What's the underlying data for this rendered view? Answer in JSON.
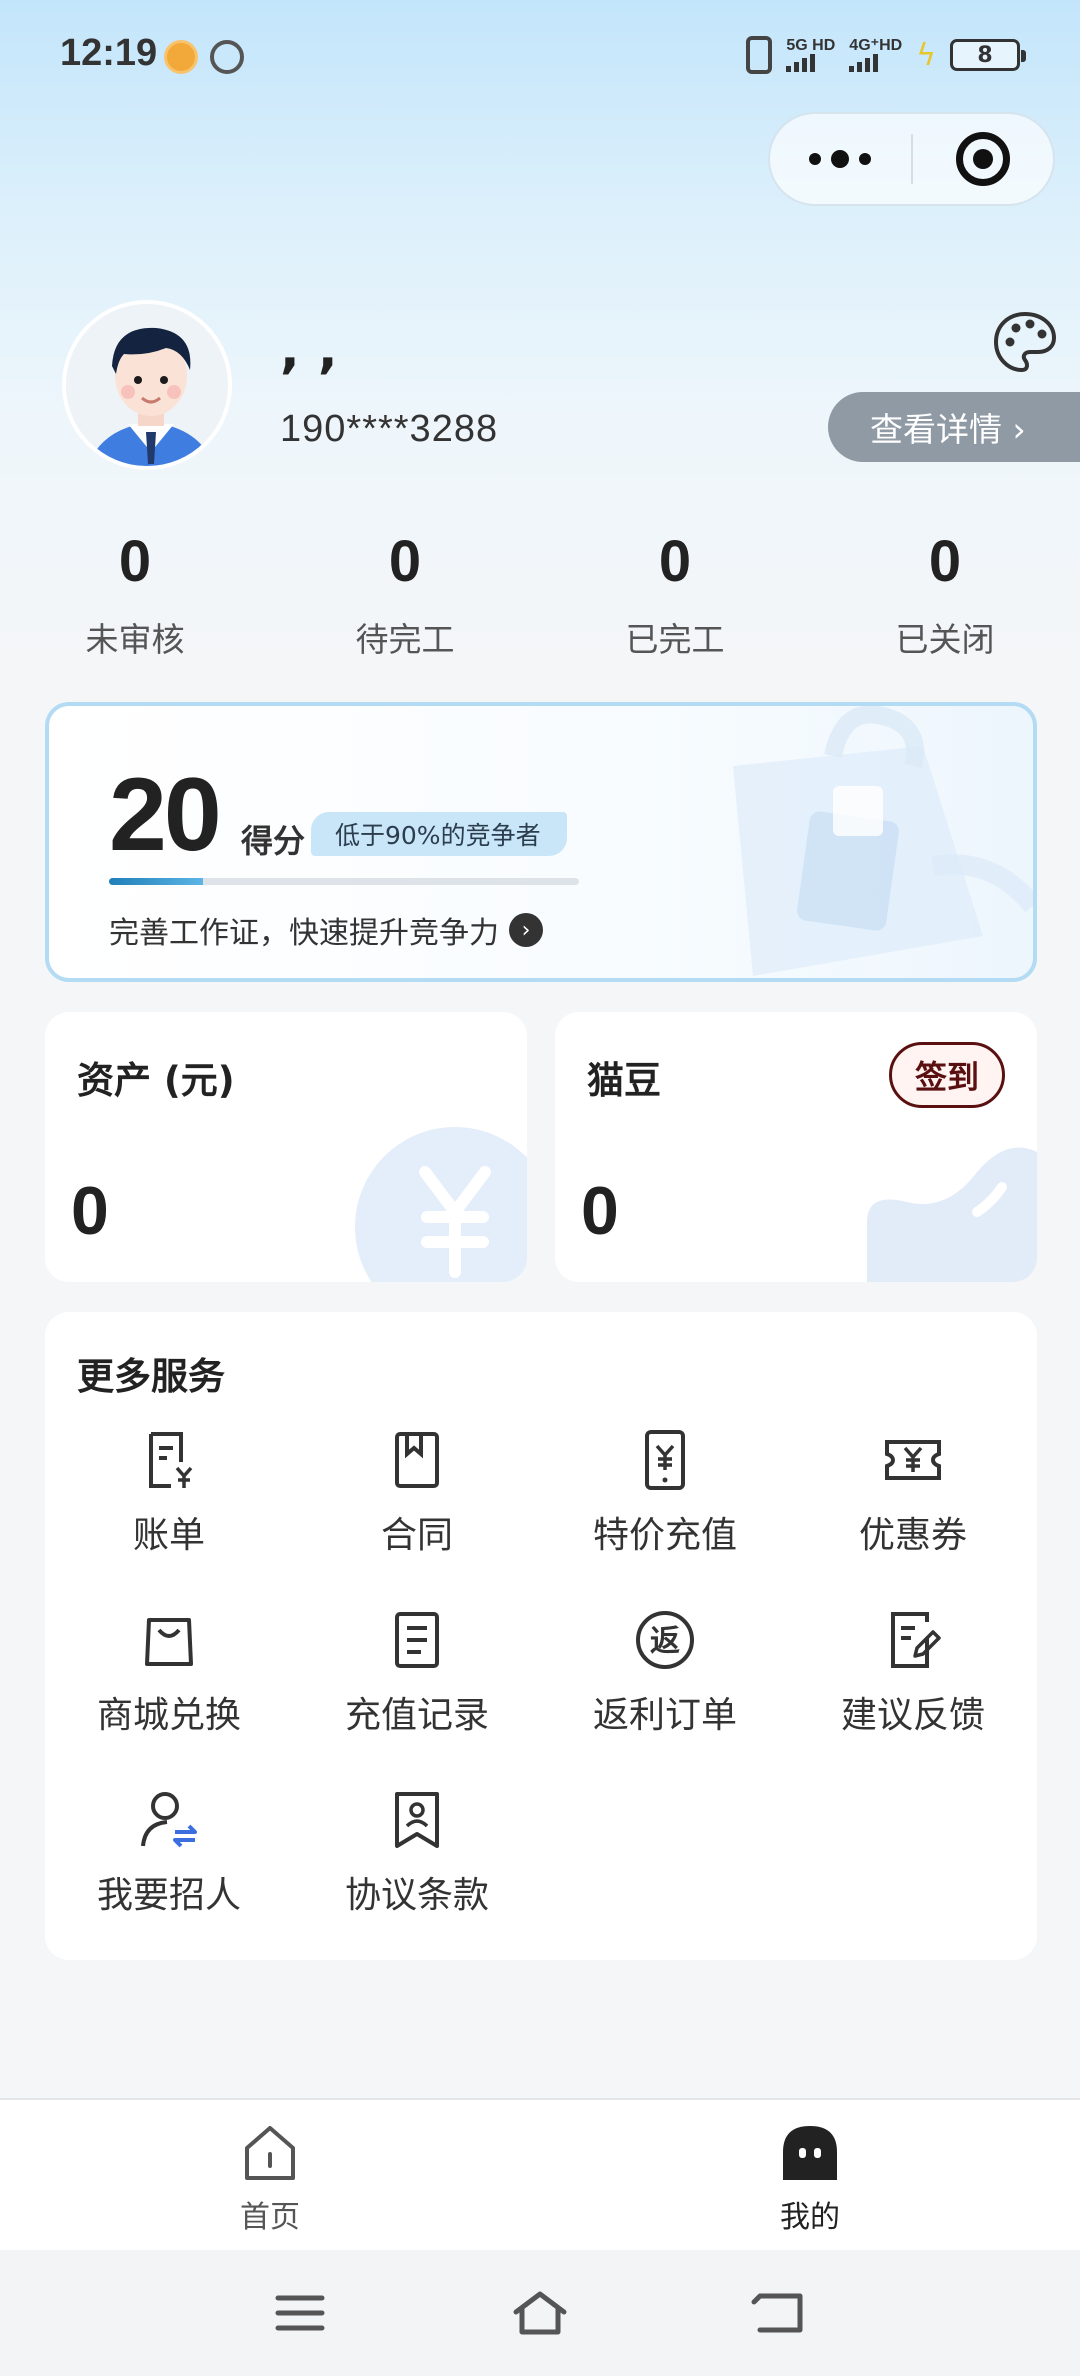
{
  "status_bar": {
    "time": "12:19",
    "sim1_label": "5G HD",
    "sim2_label": "4G⁺HD",
    "battery": "8"
  },
  "profile": {
    "nickname": ", ,",
    "phone": "190****3288",
    "detail_button": "查看详情 ›"
  },
  "stats": [
    {
      "value": "0",
      "label": "未审核"
    },
    {
      "value": "0",
      "label": "待完工"
    },
    {
      "value": "0",
      "label": "已完工"
    },
    {
      "value": "0",
      "label": "已关闭"
    }
  ],
  "score": {
    "value": "20",
    "unit": "得分",
    "rank_tag": "低于90%的竞争者",
    "progress": 0.2,
    "tip": "完善工作证，快速提升竞争力"
  },
  "assets": {
    "title": "资产 (元)",
    "value": "0"
  },
  "beans": {
    "title": "猫豆",
    "value": "0",
    "signin": "签到"
  },
  "services": {
    "title": "更多服务",
    "items": [
      {
        "label": "账单",
        "icon": "bill-icon"
      },
      {
        "label": "合同",
        "icon": "contract-icon"
      },
      {
        "label": "特价充值",
        "icon": "phone-recharge-icon"
      },
      {
        "label": "优惠券",
        "icon": "coupon-icon"
      },
      {
        "label": "商城兑换",
        "icon": "shopping-bag-icon"
      },
      {
        "label": "充值记录",
        "icon": "record-icon"
      },
      {
        "label": "返利订单",
        "icon": "rebate-icon"
      },
      {
        "label": "建议反馈",
        "icon": "feedback-icon"
      },
      {
        "label": "我要招人",
        "icon": "recruit-icon"
      },
      {
        "label": "协议条款",
        "icon": "agreement-icon"
      }
    ]
  },
  "tabbar": {
    "home": "首页",
    "mine": "我的"
  },
  "colors": {
    "accent_blue": "#1f7fb8",
    "signin_red": "#5a1010",
    "detail_gray": "#8f9aa5",
    "recruit_blue": "#3b6fe0"
  }
}
